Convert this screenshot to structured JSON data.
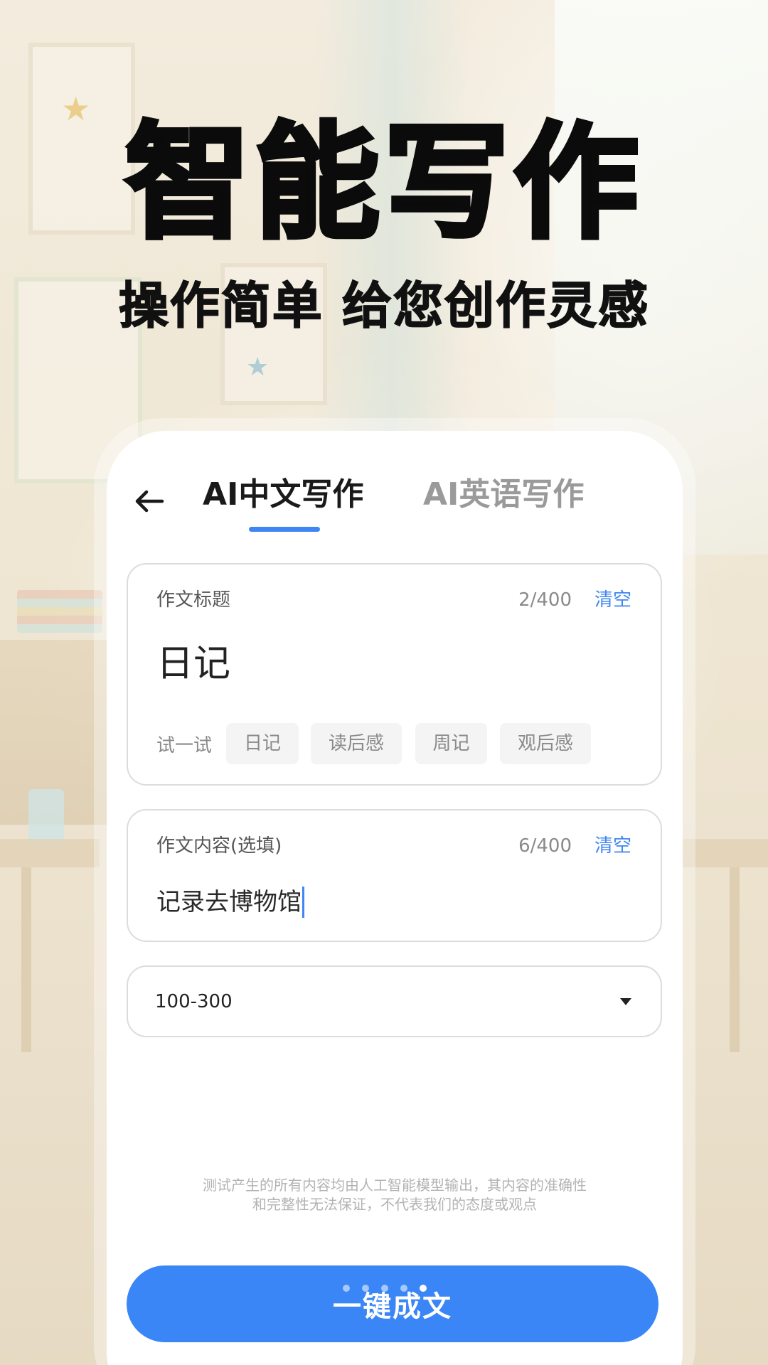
{
  "hero": {
    "title": "智能写作",
    "subtitle": "操作简单 给您创作灵感"
  },
  "header": {
    "back_icon": "arrow-left-icon",
    "tabs": [
      {
        "label": "AI中文写作",
        "active": true
      },
      {
        "label": "AI英语写作",
        "active": false
      }
    ]
  },
  "title_field": {
    "label": "作文标题",
    "count": "2/400",
    "clear_label": "清空",
    "value": "日记",
    "try_label": "试一试",
    "suggestions": [
      "日记",
      "读后感",
      "周记",
      "观后感"
    ]
  },
  "content_field": {
    "label": "作文内容(选填)",
    "count": "6/400",
    "clear_label": "清空",
    "value": "记录去博物馆"
  },
  "word_count_select": {
    "value": "100-300",
    "icon": "caret-down-icon"
  },
  "disclaimer": {
    "line1": "测试产生的所有内容均由人工智能模型输出，其内容的准确性",
    "line2": "和完整性无法保证，不代表我们的态度或观点"
  },
  "cta": {
    "label": "一键成文"
  },
  "pager": {
    "count": 5,
    "active_index": 4
  },
  "colors": {
    "accent": "#3f86f2",
    "cta": "#3b86f7",
    "text": "#1a1a1a",
    "muted": "#9a9a9a"
  }
}
